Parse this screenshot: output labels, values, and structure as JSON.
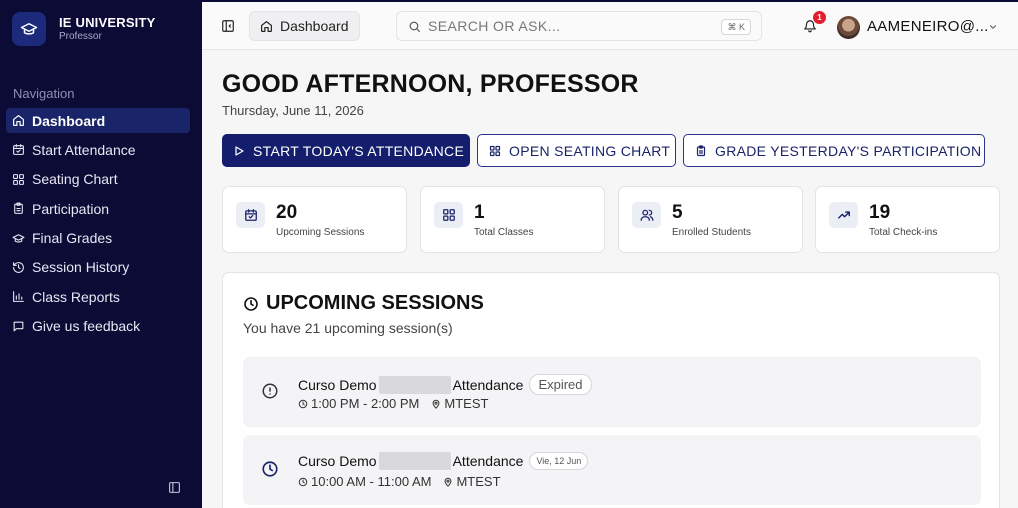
{
  "brand": {
    "title": "IE UNIVERSITY",
    "subtitle": "Professor"
  },
  "sidebar": {
    "section_label": "Navigation",
    "items": [
      {
        "label": "Dashboard",
        "icon": "home-icon",
        "active": true
      },
      {
        "label": "Start Attendance",
        "icon": "calendar-check-icon"
      },
      {
        "label": "Seating Chart",
        "icon": "grid-icon"
      },
      {
        "label": "Participation",
        "icon": "clipboard-icon"
      },
      {
        "label": "Final Grades",
        "icon": "graduation-cap-icon"
      },
      {
        "label": "Session History",
        "icon": "history-icon"
      },
      {
        "label": "Class Reports",
        "icon": "bar-chart-icon"
      },
      {
        "label": "Give us feedback",
        "icon": "message-icon"
      }
    ]
  },
  "topbar": {
    "breadcrumb": "Dashboard",
    "search_placeholder": "SEARCH OR ASK...",
    "shortcut": "⌘ K",
    "notification_count": "1",
    "user": "AAMENEIRO@..."
  },
  "main": {
    "greeting": "GOOD AFTERNOON, PROFESSOR",
    "date": "Thursday, June 11, 2026",
    "actions": {
      "start_attendance": "START TODAY'S ATTENDANCE",
      "seating_chart": "OPEN SEATING CHART",
      "grade_participation": "GRADE YESTERDAY'S PARTICIPATION"
    },
    "stats": [
      {
        "value": "20",
        "label": "Upcoming Sessions",
        "icon": "calendar-icon"
      },
      {
        "value": "1",
        "label": "Total Classes",
        "icon": "grid-icon"
      },
      {
        "value": "5",
        "label": "Enrolled Students",
        "icon": "users-icon"
      },
      {
        "value": "19",
        "label": "Total Check-ins",
        "icon": "trending-up-icon"
      }
    ],
    "upcoming": {
      "title": "UPCOMING SESSIONS",
      "subtitle": "You have 21 upcoming session(s)",
      "sessions": [
        {
          "title_start": "Curso Demo",
          "title_end": "Attendance",
          "status": "Expired",
          "time": "1:00 PM - 2:00 PM",
          "location": "MTEST",
          "icon": "alert-circle-icon"
        },
        {
          "title_start": "Curso Demo",
          "title_end": "Attendance",
          "status": "Vie, 12 Jun",
          "time": "10:00 AM - 11:00 AM",
          "location": "MTEST",
          "icon": "clock-icon"
        }
      ]
    }
  },
  "colors": {
    "sidebar_bg": "#0b0b36",
    "accent": "#151e6d",
    "active_item": "#1a2569",
    "notification": "#e11d2e"
  }
}
